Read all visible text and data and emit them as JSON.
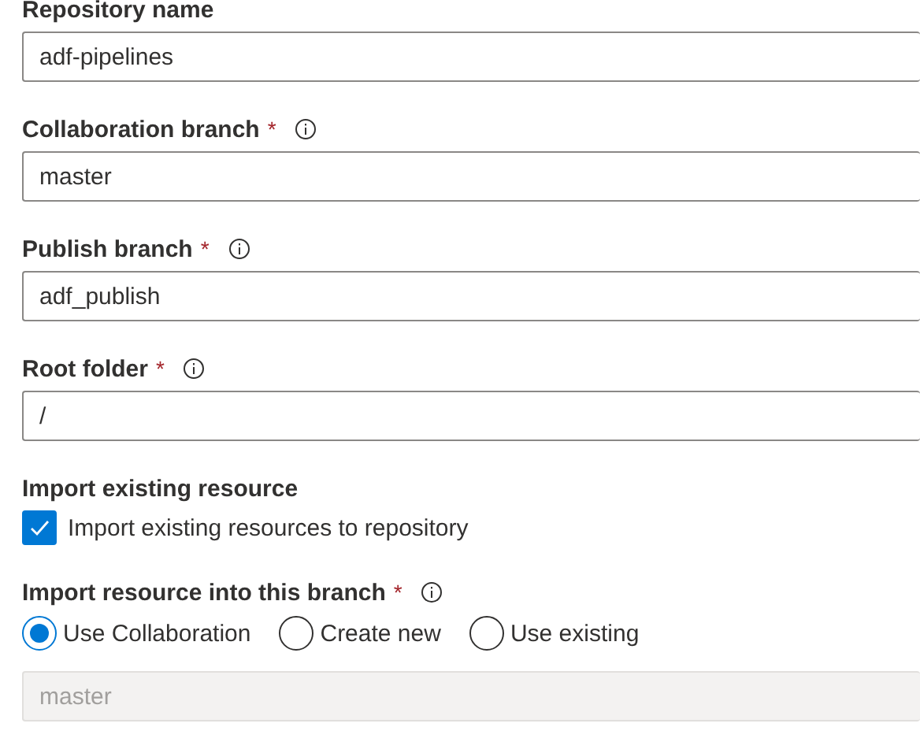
{
  "form": [
    {
      "kind": "text",
      "label": "Repository name",
      "value": "adf-pipelines",
      "disabled": false
    },
    {
      "kind": "text",
      "label": "Collaboration branch",
      "required_mark": "*",
      "info": true,
      "value": "master",
      "disabled": false
    },
    {
      "kind": "text",
      "label": "Publish branch",
      "required_mark": "*",
      "info": true,
      "value": "adf_publish",
      "disabled": false
    },
    {
      "kind": "text",
      "label": "Root folder",
      "required_mark": "*",
      "info": true,
      "value": "/",
      "disabled": false
    },
    {
      "kind": "checkbox",
      "label": "Import existing resource",
      "option": "Import existing resources to repository",
      "checked": true
    },
    {
      "kind": "radio",
      "label": "Import resource into this branch",
      "required_mark": "*",
      "info": true,
      "options": [
        {
          "label": "Use Collaboration",
          "selected": true
        },
        {
          "label": "Create new",
          "selected": false
        },
        {
          "label": "Use existing",
          "selected": false
        }
      ],
      "value": "master",
      "disabled": true
    }
  ]
}
